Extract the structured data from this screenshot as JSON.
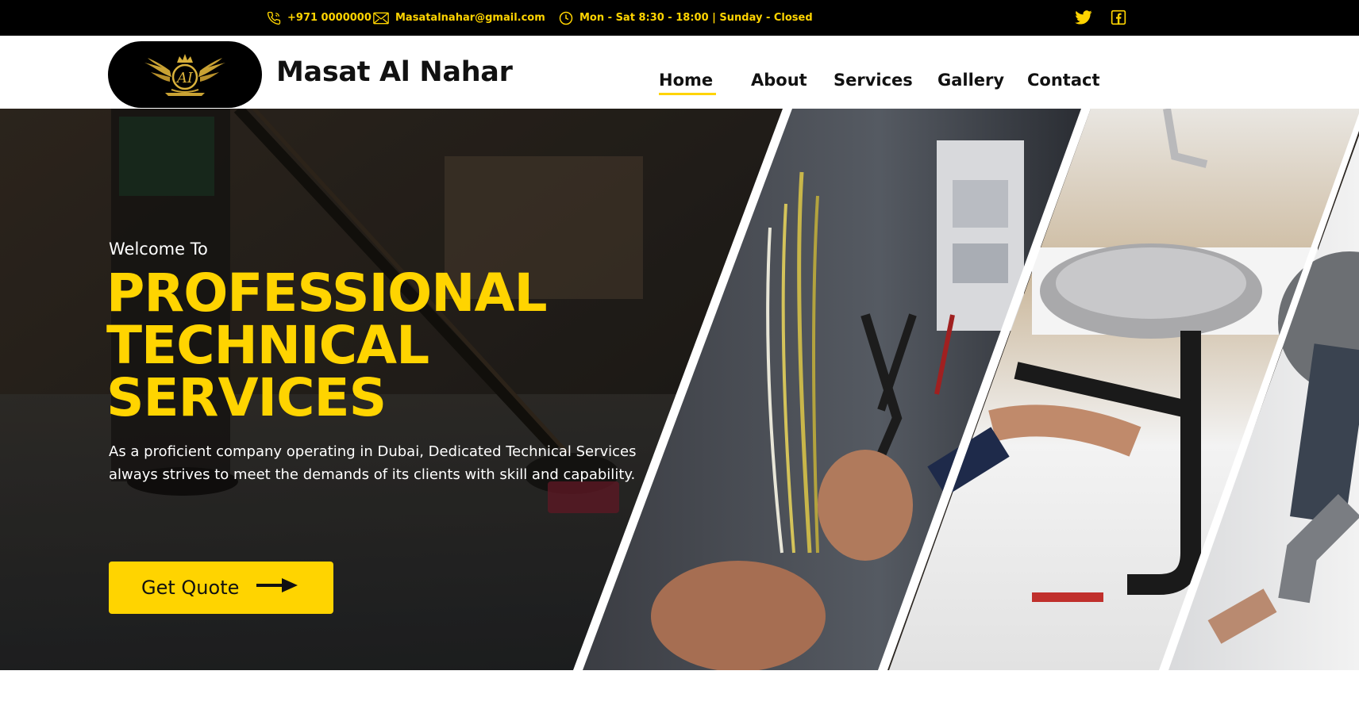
{
  "topbar": {
    "phone": "+971 0000000",
    "email": "Masatalnahar@gmail.com",
    "hours": "Mon - Sat 8:30 - 18:00 | Sunday - Closed",
    "icons": {
      "phone": "phone-icon",
      "email": "envelope-icon",
      "hours": "clock-icon",
      "twitter": "twitter-icon",
      "facebook": "facebook-icon"
    }
  },
  "header": {
    "brand": "Masat Al Nahar",
    "nav": [
      {
        "label": "Home",
        "active": true
      },
      {
        "label": "About",
        "active": false
      },
      {
        "label": "Services",
        "active": false
      },
      {
        "label": "Gallery",
        "active": false
      },
      {
        "label": "Contact",
        "active": false
      }
    ]
  },
  "hero": {
    "welcome": "Welcome To",
    "headline_lines": [
      "PROFESSIONAL",
      "TECHNICAL",
      "SERVICES"
    ],
    "description": "As a proficient company operating in Dubai, Dedicated Technical Services always strives to meet the demands of its clients with skill and capability.",
    "cta_label": "Get Quote"
  },
  "colors": {
    "accent": "#ffd400",
    "topbar_bg": "#000000",
    "text_dark": "#111111",
    "white": "#ffffff"
  }
}
